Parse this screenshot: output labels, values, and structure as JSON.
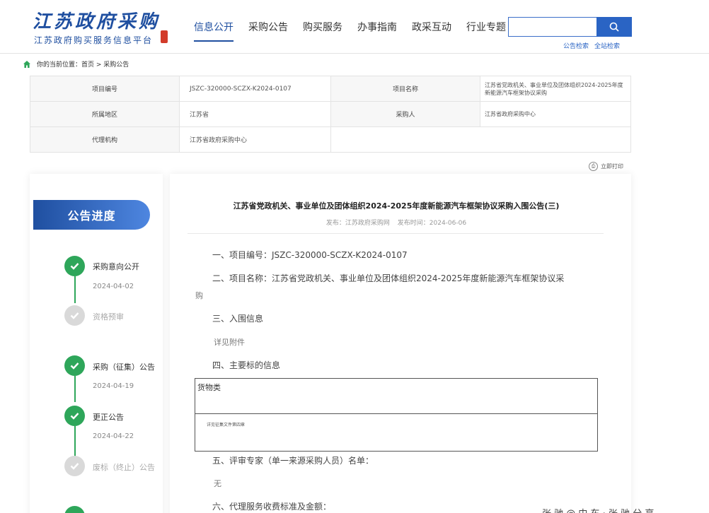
{
  "header": {
    "logo_title": "江苏政府采购",
    "logo_subtitle": "江苏政府购买服务信息平台",
    "nav": [
      "信息公开",
      "采购公告",
      "购买服务",
      "办事指南",
      "政采互动",
      "行业专题"
    ],
    "search_placeholder": "",
    "search_links": [
      "公告检索",
      "全站检索"
    ]
  },
  "breadcrumb": {
    "prefix": "你的当前位置：",
    "path": "首页 > 采购公告"
  },
  "info": {
    "project_no_label": "项目编号",
    "project_no": "JSZC-320000-SCZX-K2024-0107",
    "project_name_label": "项目名称",
    "project_name": "江苏省党政机关、事业单位及团体组织2024-2025年度新能源汽车框架协议采购",
    "region_label": "所属地区",
    "region": "江苏省",
    "buyer_label": "采购人",
    "buyer": "江苏省政府采购中心",
    "agency_label": "代理机构",
    "agency": "江苏省政府采购中心"
  },
  "print_label": "立即打印",
  "progress": {
    "title": "公告进度",
    "steps": [
      {
        "name": "采购意向公开",
        "date": "2024-04-02",
        "done": true
      },
      {
        "name": "资格预审",
        "date": "",
        "done": false
      },
      {
        "name": "采购（征集）公告",
        "date": "2024-04-19",
        "done": true
      },
      {
        "name": "更正公告",
        "date": "2024-04-22",
        "done": true
      },
      {
        "name": "废标（终止）公告",
        "date": "",
        "done": false
      }
    ]
  },
  "doc": {
    "title": "江苏省党政机关、事业单位及团体组织2024-2025年度新能源汽车框架协议采购入围公告(三)",
    "publisher": "发布：江苏政府采购网",
    "publish_time": "发布时间：2024-06-06",
    "s1": "一、项目编号：JSZC-320000-SCZX-K2024-0107",
    "s2a": "二、项目名称：江苏省党政机关、事业单位及团体组织2024-2025年度新能源汽车框架协议采",
    "s2b": "购",
    "s3": "三、入围信息",
    "s3_body": "详见附件",
    "s4": "四、主要标的信息",
    "goods_header": "货物类",
    "goods_note": "详见征集文件第四章",
    "s5": "五、评审专家（单一来源采购人员）名单：",
    "s5_body": "无",
    "s6": "六、代理服务收费标准及金额："
  },
  "watermark": "张 驰  @ 中 车 · 张 驰 分 享"
}
